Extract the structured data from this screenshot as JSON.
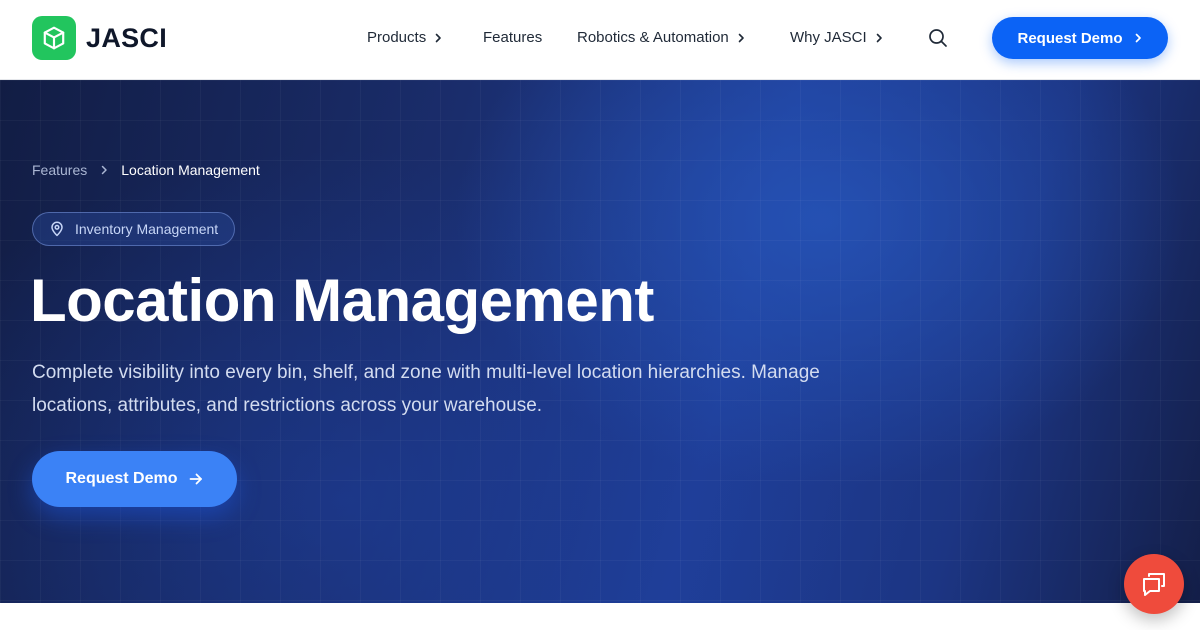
{
  "brand": {
    "name": "JASCI",
    "logo_icon": "cube-icon",
    "logo_color": "#22c55e"
  },
  "nav": {
    "items": [
      {
        "label": "Products",
        "has_chevron": true
      },
      {
        "label": "Features",
        "has_chevron": false
      },
      {
        "label": "Robotics & Automation",
        "has_chevron": true
      },
      {
        "label": "Why JASCI",
        "has_chevron": true
      }
    ],
    "search_icon": "search-icon",
    "cta_label": "Request Demo"
  },
  "hero": {
    "breadcrumb": {
      "parent": "Features",
      "current": "Location Management"
    },
    "badge": "Inventory Management",
    "title": "Location Management",
    "description": "Complete visibility into every bin, shelf, and zone with multi-level location hierarchies. Manage locations, attributes, and restrictions across your warehouse.",
    "cta_label": "Request Demo"
  },
  "chat": {
    "icon": "chat-bubbles-icon"
  },
  "colors": {
    "primary": "#0b63f6",
    "hero_cta": "#3b82f6",
    "chat": "#ef4b3c",
    "hero_bg": "#1f3e98"
  }
}
